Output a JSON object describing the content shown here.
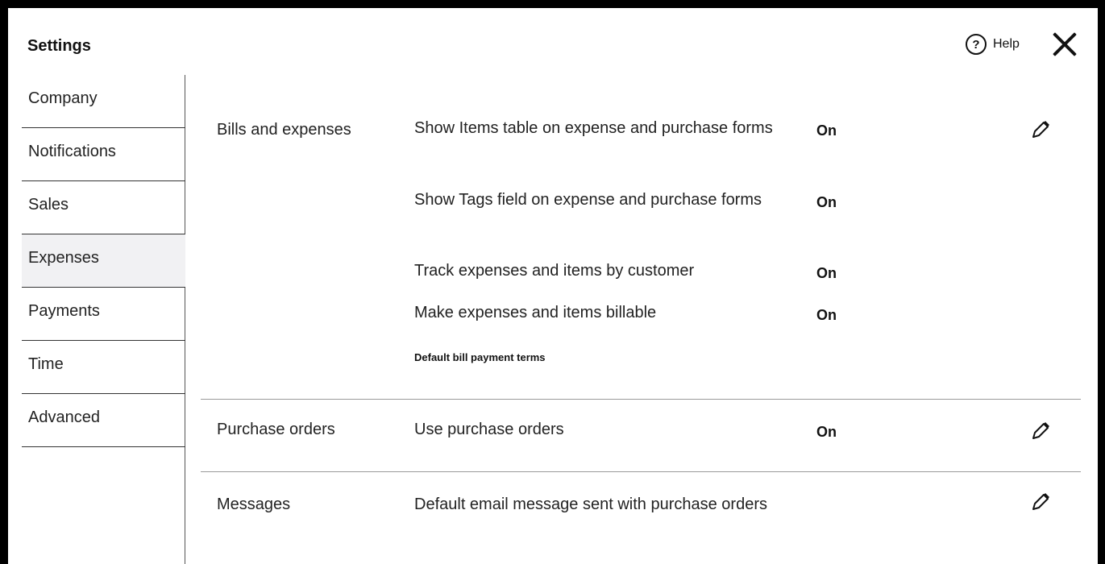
{
  "header": {
    "title": "Settings",
    "help_label": "Help"
  },
  "sidebar": {
    "items": [
      {
        "label": "Company"
      },
      {
        "label": "Notifications"
      },
      {
        "label": "Sales"
      },
      {
        "label": "Expenses",
        "selected": true
      },
      {
        "label": "Payments"
      },
      {
        "label": "Time"
      },
      {
        "label": "Advanced"
      }
    ]
  },
  "sections": {
    "bills": {
      "label": "Bills and expenses",
      "rows": [
        {
          "text": "Show Items table on expense and purchase forms",
          "value": "On"
        },
        {
          "text": "Show Tags field on expense and purchase forms",
          "value": "On"
        },
        {
          "text": "Track expenses and items by customer",
          "value": "On"
        },
        {
          "text": "Make expenses and items billable",
          "value": "On"
        }
      ],
      "terms_label": "Default bill payment terms"
    },
    "purchase_orders": {
      "label": "Purchase orders",
      "rows": [
        {
          "text": "Use purchase orders",
          "value": "On"
        }
      ]
    },
    "messages": {
      "label": "Messages",
      "rows": [
        {
          "text": "Default email message sent with purchase orders"
        }
      ]
    }
  },
  "icons": {
    "help": "help-circle-icon",
    "close": "close-icon",
    "edit": "pencil-icon"
  },
  "colors": {
    "selected_nav_bg": "#f1f1f3",
    "divider": "#999999",
    "text": "#222222"
  }
}
